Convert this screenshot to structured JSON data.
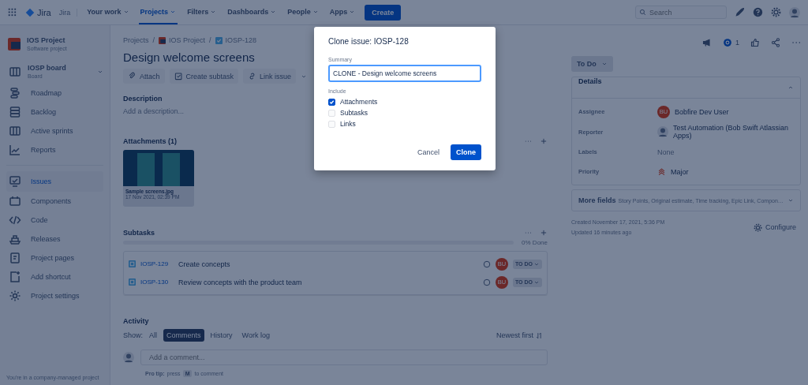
{
  "nav": {
    "product": "Jira",
    "site": "Jira",
    "items": [
      {
        "label": "Your work",
        "selected": false
      },
      {
        "label": "Projects",
        "selected": true
      },
      {
        "label": "Filters",
        "selected": false
      },
      {
        "label": "Dashboards",
        "selected": false
      },
      {
        "label": "People",
        "selected": false
      },
      {
        "label": "Apps",
        "selected": false
      }
    ],
    "create": "Create",
    "search": {
      "placeholder": "Search"
    }
  },
  "sidebar": {
    "project": {
      "name": "IOS Project",
      "type": "Software project"
    },
    "board": {
      "name": "IOSP board",
      "type": "Board"
    },
    "items": [
      {
        "label": "Roadmap",
        "selected": false
      },
      {
        "label": "Backlog",
        "selected": false
      },
      {
        "label": "Active sprints",
        "selected": false
      },
      {
        "label": "Reports",
        "selected": false
      }
    ],
    "items2": [
      {
        "label": "Issues",
        "selected": true
      },
      {
        "label": "Components",
        "selected": false
      },
      {
        "label": "Code",
        "selected": false
      },
      {
        "label": "Releases",
        "selected": false
      },
      {
        "label": "Project pages",
        "selected": false
      },
      {
        "label": "Add shortcut",
        "selected": false
      },
      {
        "label": "Project settings",
        "selected": false
      }
    ],
    "footer": "You're in a company-managed project"
  },
  "issue": {
    "breadcrumbs": [
      "Projects",
      "IOS Project",
      "IOSP-128"
    ],
    "breadcrumb_separator": "/",
    "title": "Design welcome screens",
    "actions": [
      "Attach",
      "Create subtask",
      "Link issue"
    ],
    "description": {
      "heading": "Description",
      "placeholder": "Add a description..."
    },
    "attachments": {
      "heading": "Attachments (1)",
      "files": [
        {
          "name": "Sample screens.jpg",
          "date": "17 Nov 2021, 02:39 PM"
        }
      ]
    },
    "subtasks": {
      "heading": "Subtasks",
      "level": 0,
      "progress": "0% Done",
      "rows": [
        {
          "key": "IOSP-129",
          "summary": "Create concepts",
          "assignee": "BU",
          "status": "TO DO"
        },
        {
          "key": "IOSP-130",
          "summary": "Review concepts with the product team",
          "assignee": "BU",
          "status": "TO DO"
        }
      ]
    },
    "activity": {
      "heading": "Activity",
      "show": "Show:",
      "filters": [
        {
          "label": "All",
          "selected": false
        },
        {
          "label": "Comments",
          "selected": true
        },
        {
          "label": "History",
          "selected": false
        },
        {
          "label": "Work log",
          "selected": false
        }
      ],
      "sort": "Newest first",
      "comment_placeholder": "Add a comment...",
      "tip_label": "Pro tip:",
      "tip_before": "press",
      "tip_key": "M",
      "tip_after": "to comment"
    }
  },
  "side": {
    "watchers": "1",
    "status": "To Do",
    "details": {
      "heading": "Details",
      "fields": [
        {
          "label": "Assignee",
          "value": "Bobfire Dev User",
          "kind": "initials",
          "initials": "BU"
        },
        {
          "label": "Reporter",
          "value": "Test Automation (Bob Swift Atlassian Apps)",
          "kind": "person"
        },
        {
          "label": "Labels",
          "value": "None",
          "kind": "empty"
        },
        {
          "label": "Priority",
          "value": "Major",
          "kind": "priority"
        }
      ]
    },
    "more_fields": {
      "label": "More fields",
      "hint": "Story Points, Original estimate, Time tracking, Epic Link, Compon…"
    },
    "created": "Created November 17, 2021, 5:36 PM",
    "updated": "Updated 16 minutes ago",
    "configure": "Configure"
  },
  "dialog": {
    "title": "Clone issue: IOSP-128",
    "summary_label": "Summary",
    "summary": "CLONE - Design welcome screens",
    "include_label": "Include",
    "options": [
      {
        "label": "Attachments",
        "checked": true
      },
      {
        "label": "Subtasks",
        "checked": false
      },
      {
        "label": "Links",
        "checked": false
      }
    ],
    "cancel": "Cancel",
    "confirm": "Clone"
  }
}
